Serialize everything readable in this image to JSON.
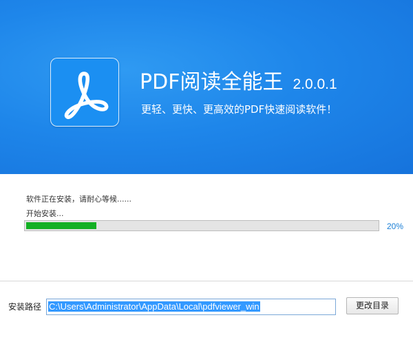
{
  "header": {
    "app_name": "PDF阅读全能王",
    "version": "2.0.0.1",
    "tagline": "更轻、更快、更高效的PDF快速阅读软件！",
    "logo_icon": "acrobat-pdf-icon"
  },
  "progress": {
    "status_text": "软件正在安装，请耐心等候......",
    "step_text": "开始安装...",
    "percent": 20,
    "percent_label": "20%"
  },
  "install_path": {
    "label": "安装路径",
    "value": "C:\\Users\\Administrator\\AppData\\Local\\pdfviewer_win",
    "change_button_label": "更改目录"
  },
  "colors": {
    "banner_blue": "#1e86ea",
    "progress_green": "#13b024",
    "percent_blue": "#1a7fd6",
    "selection_blue": "#3399ff"
  }
}
